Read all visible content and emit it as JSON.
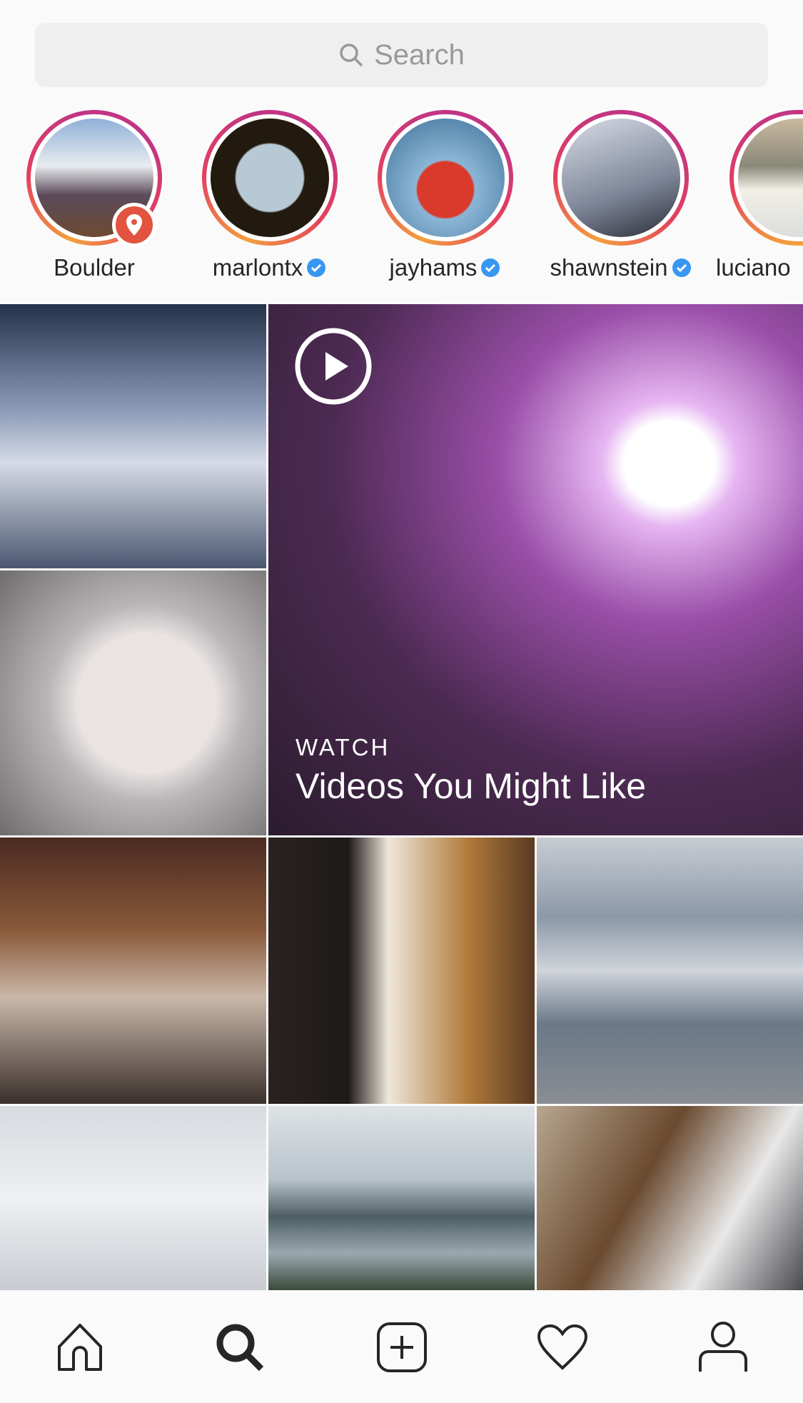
{
  "search": {
    "placeholder": "Search",
    "icon": "search-icon"
  },
  "stories": [
    {
      "label": "Boulder",
      "verified": false,
      "badge": "location-pin-icon"
    },
    {
      "label": "marlontx",
      "verified": true
    },
    {
      "label": "jayhams",
      "verified": true
    },
    {
      "label": "shawnstein",
      "verified": true
    },
    {
      "label": "luciano",
      "verified": false
    }
  ],
  "featured": {
    "kicker": "WATCH",
    "title": "Videos You Might Like",
    "icon": "play-icon"
  },
  "colors": {
    "verified": "#3897f0",
    "ring_start": "#f2a03d",
    "ring_end": "#c13584",
    "location_badge": "#e2543f"
  },
  "nav": {
    "items": [
      "home-icon",
      "search-icon",
      "add-post-icon",
      "heart-icon",
      "profile-icon"
    ],
    "active": "search-icon"
  }
}
